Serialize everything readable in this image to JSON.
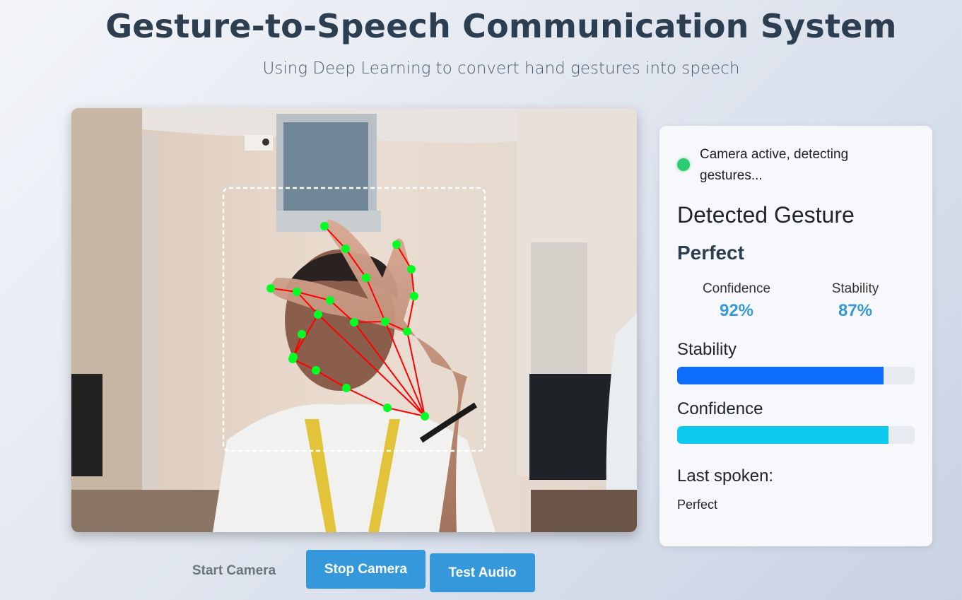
{
  "header": {
    "title": "Gesture-to-Speech Communication System",
    "subtitle": "Using Deep Learning to convert hand gestures into speech"
  },
  "status": {
    "text": "Camera active, detecting gestures...",
    "indicator_color": "#2ecc71"
  },
  "detection": {
    "heading": "Detected Gesture",
    "gesture": "Perfect",
    "metrics": [
      {
        "label": "Confidence",
        "value": "92%"
      },
      {
        "label": "Stability",
        "value": "87%"
      }
    ]
  },
  "bars": {
    "stability": {
      "label": "Stability",
      "level": 0.87,
      "color": "#0d6efd"
    },
    "confidence": {
      "label": "Confidence",
      "level": 0.89,
      "color": "#0dcaf0"
    }
  },
  "last_spoken": {
    "label": "Last spoken:",
    "value": "Perfect"
  },
  "controls": {
    "start_label": "Start Camera",
    "stop_label": "Stop Camera",
    "test_label": "Test Audio"
  },
  "colors": {
    "accent": "#3498db",
    "landmark": "#00ff22",
    "skeleton": "#ff0000"
  }
}
